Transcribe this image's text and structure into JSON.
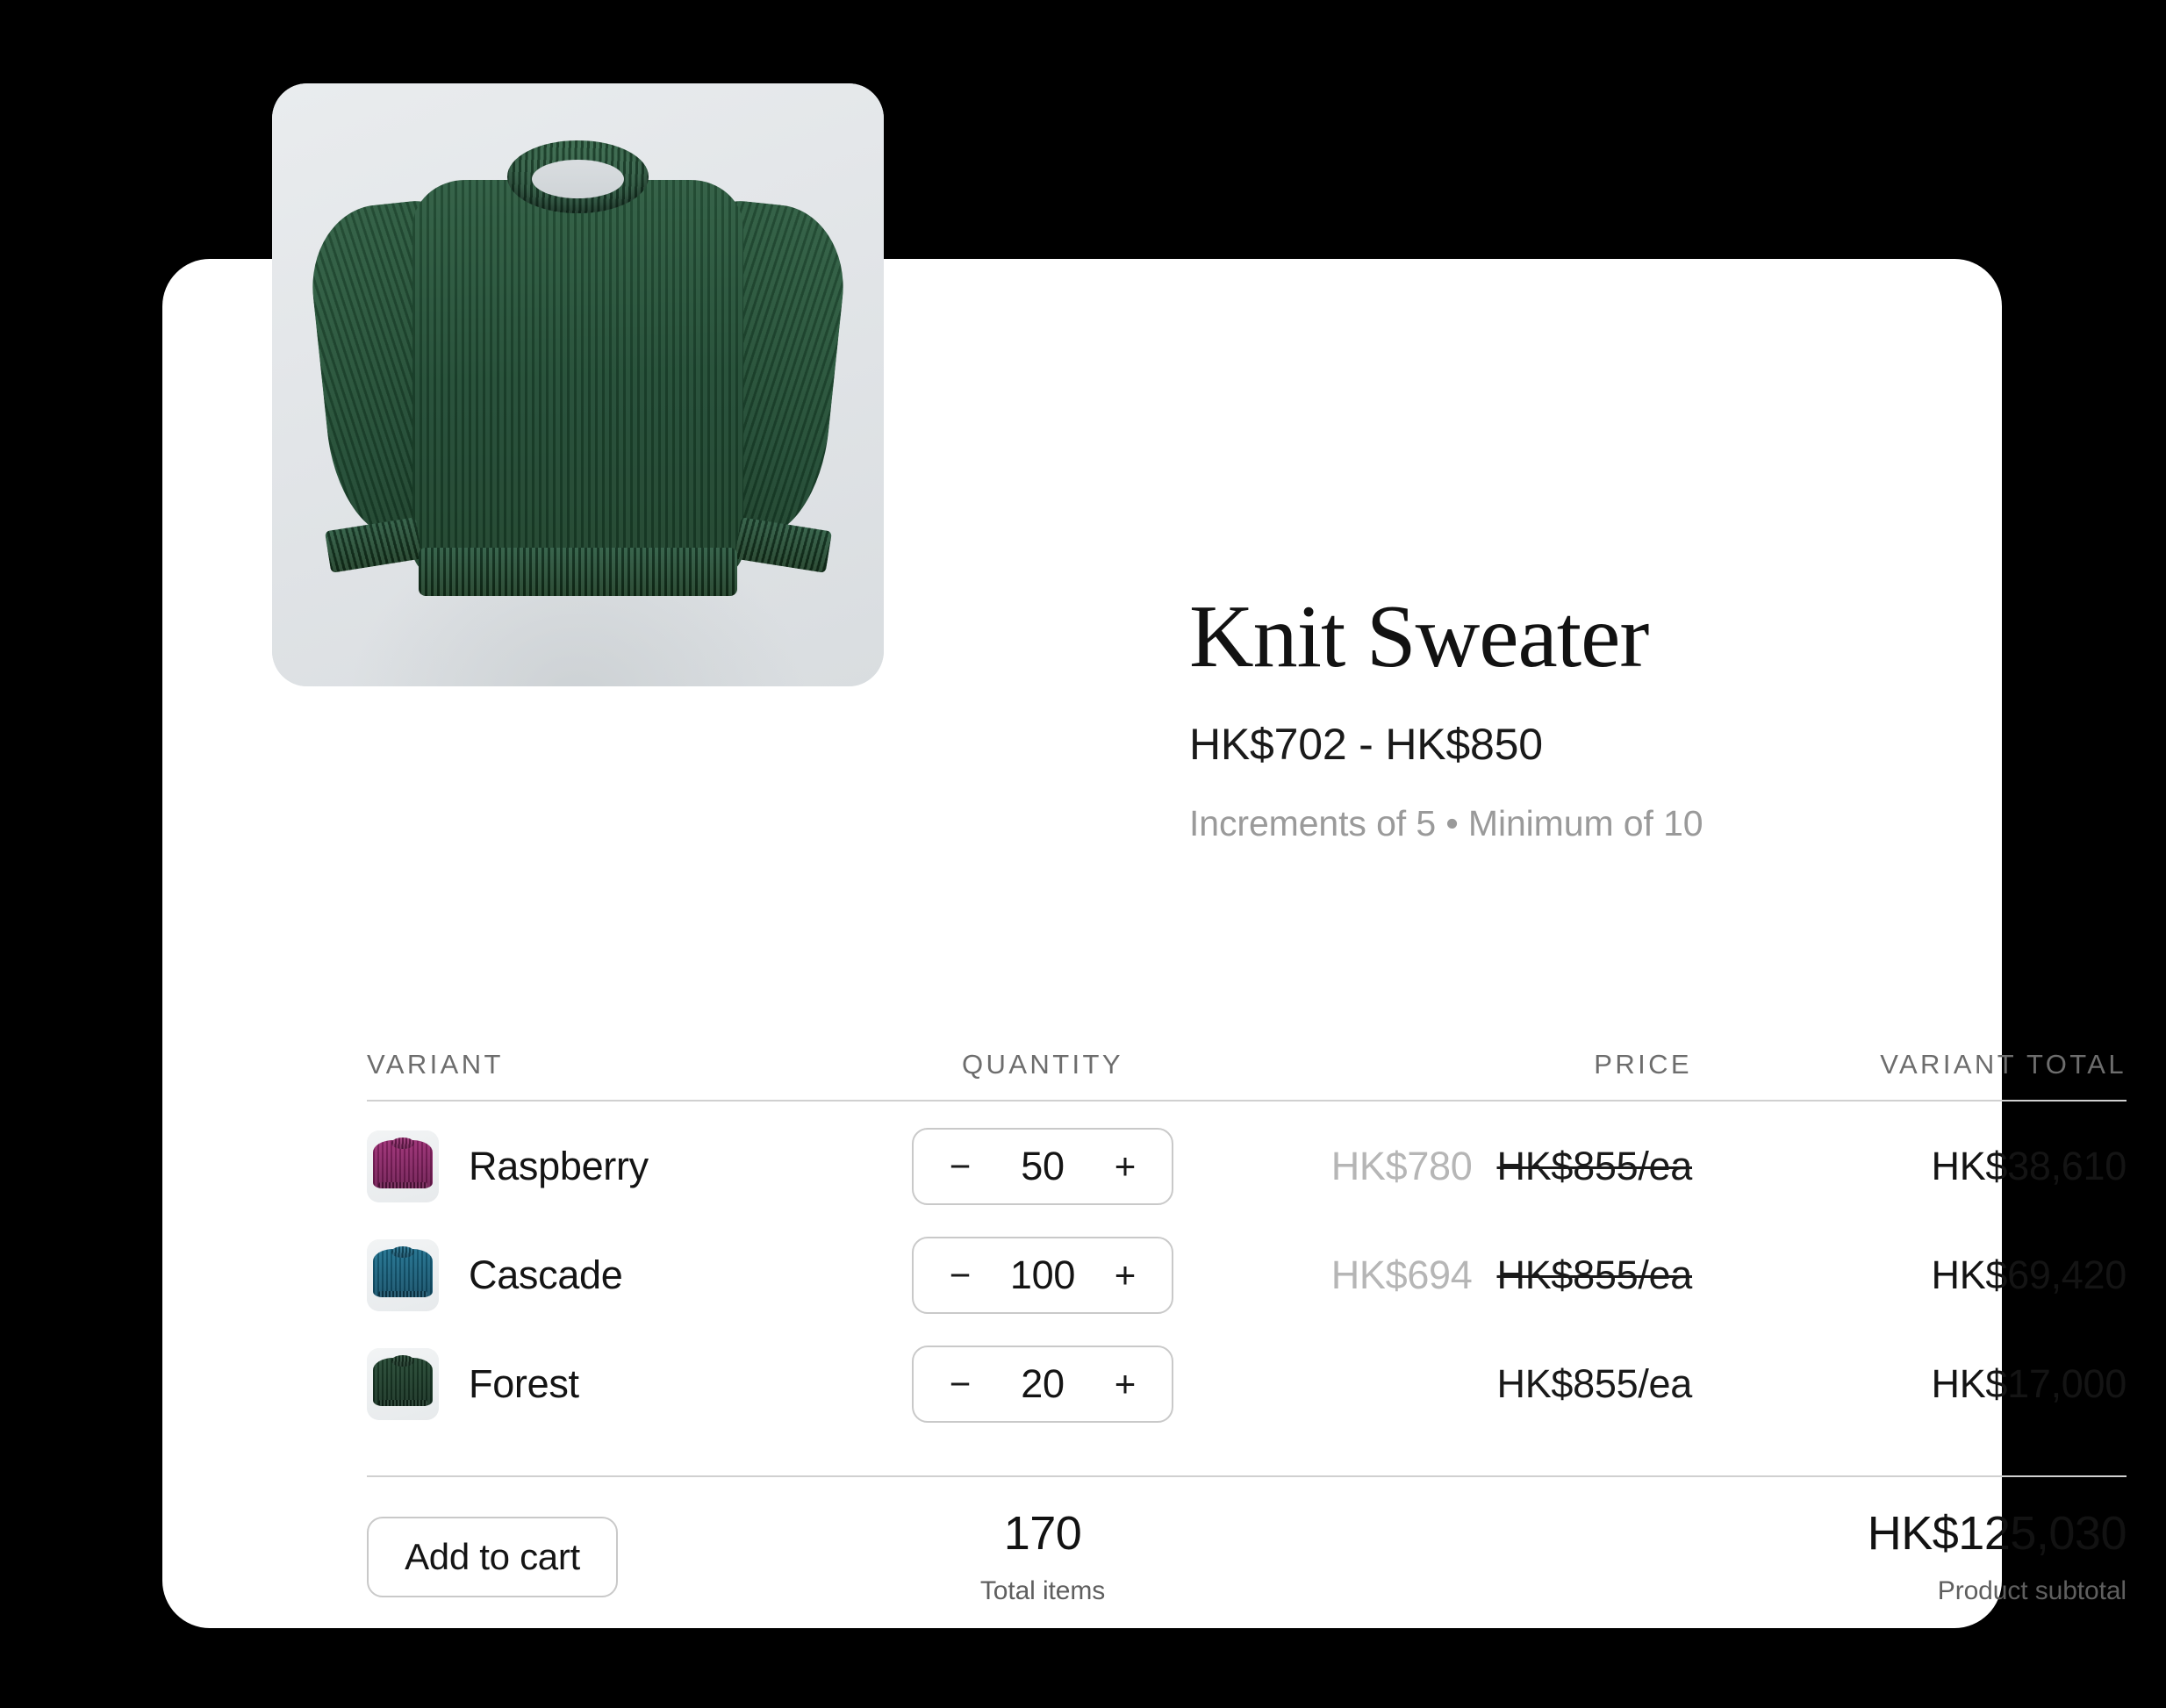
{
  "product": {
    "title": "Knit Sweater",
    "price_range": "HK$702 - HK$850",
    "meta": "Increments of 5 • Minimum of 10",
    "hero_image_alt": "green-knit-sweater-photo"
  },
  "table": {
    "headers": {
      "variant": "VARIANT",
      "quantity": "QUANTITY",
      "price": "PRICE",
      "variant_total": "VARIANT TOTAL"
    },
    "rows": [
      {
        "name": "Raspberry",
        "swatch": "#9c2a73",
        "swatch_dark": "#6d1a50",
        "quantity": "50",
        "decrement_label": "−",
        "increment_label": "+",
        "price_discount": "HK$780",
        "price_base": "HK$855/ea",
        "price_base_struck": true,
        "variant_total": "HK$38,610"
      },
      {
        "name": "Cascade",
        "swatch": "#1b6f8e",
        "swatch_dark": "#124d66",
        "quantity": "100",
        "decrement_label": "−",
        "increment_label": "+",
        "price_discount": "HK$694",
        "price_base": "HK$855/ea",
        "price_base_struck": true,
        "variant_total": "HK$69,420"
      },
      {
        "name": "Forest",
        "swatch": "#20452f",
        "swatch_dark": "#152f20",
        "quantity": "20",
        "decrement_label": "−",
        "increment_label": "+",
        "price_discount": "",
        "price_base": "HK$855/ea",
        "price_base_struck": false,
        "variant_total": "HK$17,000"
      }
    ]
  },
  "footer": {
    "add_to_cart_label": "Add to cart",
    "total_items_value": "170",
    "total_items_label": "Total items",
    "subtotal_value": "HK$125,030",
    "subtotal_label": "Product subtotal"
  },
  "colors": {
    "background": "#000000",
    "card": "#ffffff",
    "text_primary": "#141414",
    "text_muted": "#6d6d6d",
    "text_faint": "#b6b6b6",
    "divider": "#d0d0d0",
    "border": "#c9c9c9"
  }
}
